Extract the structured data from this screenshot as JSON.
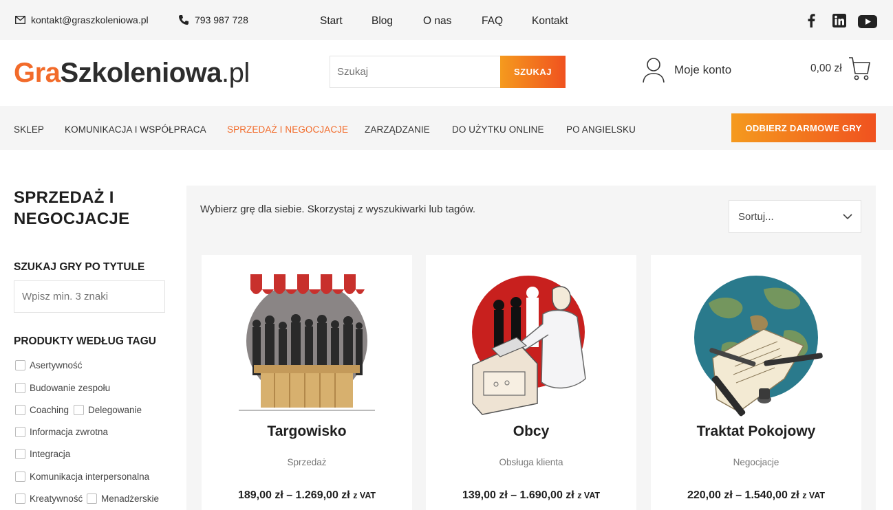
{
  "topbar": {
    "email": "kontakt@graszkoleniowa.pl",
    "phone": "793 987 728",
    "links": [
      "Start",
      "Blog",
      "O nas",
      "FAQ",
      "Kontakt"
    ],
    "social_icons": [
      "facebook-icon",
      "linkedin-icon",
      "youtube-icon"
    ]
  },
  "header": {
    "logo_part1": "Gra",
    "logo_part2": "Szkoleniowa",
    "logo_part3": ".pl",
    "search_placeholder": "Szukaj",
    "search_button": "SZUKAJ",
    "account_label": "Moje konto",
    "cart_total": "0,00 zł"
  },
  "nav": {
    "items": [
      "SKLEP",
      "KOMUNIKACJA I WSPÓŁPRACA",
      "SPRZEDAŻ I NEGOCJACJE",
      "ZARZĄDZANIE",
      "DO UŻYTKU ONLINE",
      "PO ANGIELSKU"
    ],
    "active_index": 2,
    "cta": "ODBIERZ DARMOWE GRY"
  },
  "sidebar": {
    "title_line1": "SPRZEDAŻ I",
    "title_line2": "NEGOCJACJE",
    "search_heading": "SZUKAJ GRY PO TYTULE",
    "search_placeholder": "Wpisz min. 3 znaki",
    "tags_heading": "PRODUKTY WEDŁUG TAGU",
    "tags": [
      "Asertywność",
      "Budowanie zespołu",
      "Coaching",
      "Delegowanie",
      "Informacja zwrotna",
      "Integracja",
      "Komunikacja interpersonalna",
      "Kreatywność",
      "Menadżerskie"
    ]
  },
  "main": {
    "intro": "Wybierz grę dla siebie. Skorzystaj z wyszukiwarki lub tagów.",
    "sort_label": "Sortuj...",
    "products": [
      {
        "title": "Targowisko",
        "category": "Sprzedaż",
        "price": "189,00 zł – 1.269,00 zł",
        "vat": "z VAT"
      },
      {
        "title": "Obcy",
        "category": "Obsługa klienta",
        "price": "139,00 zł – 1.690,00 zł",
        "vat": "z VAT"
      },
      {
        "title": "Traktat Pokojowy",
        "category": "Negocjacje",
        "price": "220,00 zł – 1.540,00 zł",
        "vat": "z VAT"
      }
    ]
  },
  "colors": {
    "accent": "#f26b2a",
    "accent_gradient_start": "#f59a1e",
    "bar_bg": "#f5f5f5"
  }
}
